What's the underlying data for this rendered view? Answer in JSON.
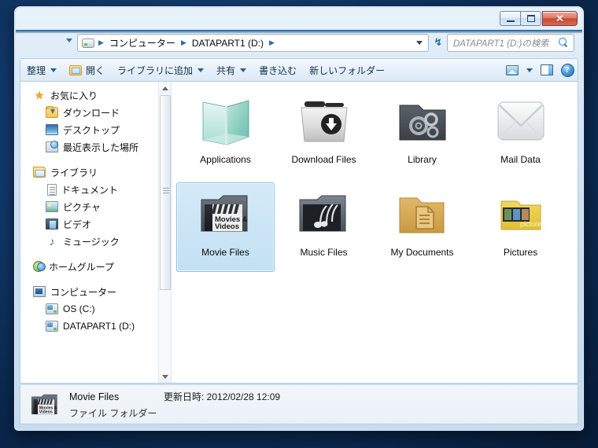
{
  "window": {
    "buttons": {
      "minimize": "minimize",
      "maximize": "maximize",
      "close": "✕"
    }
  },
  "address": {
    "back_glyph": "←",
    "forward_glyph": "➔",
    "drive_icon": "drive-icon",
    "crumbs": [
      "コンピューター",
      "DATAPART1 (D:)"
    ],
    "separator": "▶",
    "refresh_glyph": "↯"
  },
  "search": {
    "placeholder": "DATAPART1 (D:)の検索",
    "icon": "search-icon"
  },
  "toolbar": {
    "organize": "整理",
    "open": "開く",
    "add_to_library": "ライブラリに追加",
    "share": "共有",
    "burn": "書き込む",
    "new_folder": "新しいフォルダー",
    "view_icon": "view-mode-icon",
    "preview_icon": "preview-pane-icon",
    "help_icon": "?"
  },
  "sidebar": {
    "groups": [
      {
        "header": {
          "label": "お気に入り",
          "icon": "star-icon"
        },
        "items": [
          {
            "label": "ダウンロード",
            "icon": "downloads-folder-icon"
          },
          {
            "label": "デスクトップ",
            "icon": "desktop-icon"
          },
          {
            "label": "最近表示した場所",
            "icon": "recent-places-icon"
          }
        ]
      },
      {
        "header": {
          "label": "ライブラリ",
          "icon": "library-icon"
        },
        "items": [
          {
            "label": "ドキュメント",
            "icon": "documents-icon"
          },
          {
            "label": "ピクチャ",
            "icon": "pictures-icon"
          },
          {
            "label": "ビデオ",
            "icon": "videos-icon"
          },
          {
            "label": "ミュージック",
            "icon": "music-icon"
          }
        ]
      },
      {
        "header": {
          "label": "ホームグループ",
          "icon": "homegroup-icon"
        },
        "items": []
      },
      {
        "header": {
          "label": "コンピューター",
          "icon": "computer-icon"
        },
        "items": [
          {
            "label": "OS (C:)",
            "icon": "drive-icon"
          },
          {
            "label": "DATAPART1 (D:)",
            "icon": "drive-icon"
          }
        ]
      }
    ]
  },
  "files": [
    {
      "label": "Applications",
      "icon": "applications-glass-folder-icon",
      "selected": false
    },
    {
      "label": "Download Files",
      "icon": "download-folder-icon",
      "selected": false
    },
    {
      "label": "Library",
      "icon": "gears-folder-icon",
      "selected": false
    },
    {
      "label": "Mail Data",
      "icon": "envelope-icon",
      "selected": false
    },
    {
      "label": "Movie Files",
      "icon": "clapperboard-folder-icon",
      "selected": true,
      "icon_text_line1": "Movies &",
      "icon_text_line2": "Videos"
    },
    {
      "label": "Music Files",
      "icon": "music-notes-folder-icon",
      "selected": false
    },
    {
      "label": "My Documents",
      "icon": "documents-folder-icon",
      "selected": false
    },
    {
      "label": "Pictures",
      "icon": "pictures-folder-icon",
      "selected": false,
      "icon_text_line1": "pictures"
    }
  ],
  "status": {
    "name": "Movie Files",
    "date": "更新日時: 2012/02/28 12:09",
    "type": "ファイル フォルダー",
    "icon": "clapperboard-folder-icon"
  },
  "colors": {
    "selection": "#c3e0f4",
    "selection_border": "#8cc4e6",
    "accent": "#2f6ea5",
    "close_button": "#c64b36"
  }
}
